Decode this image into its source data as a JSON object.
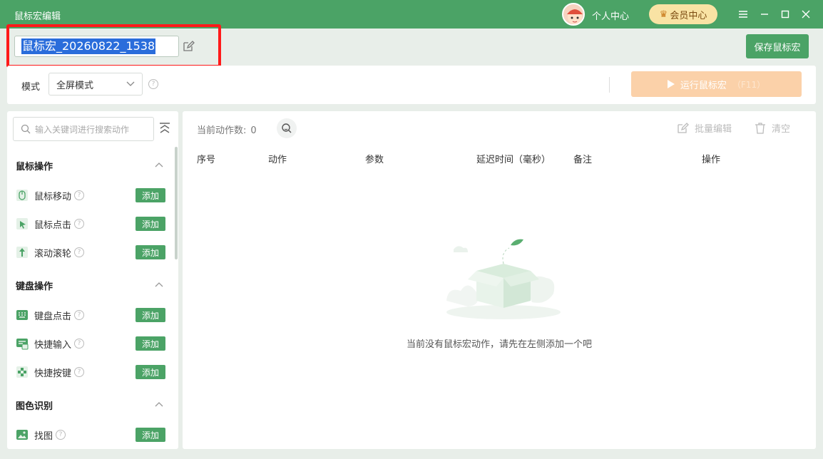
{
  "titlebar": {
    "title": "鼠标宏编辑",
    "user_center": "个人中心",
    "vip": "会员中心"
  },
  "header": {
    "macro_name": "鼠标宏_20260822_1538",
    "save_label": "保存鼠标宏"
  },
  "mode": {
    "label": "模式",
    "selected": "全屏模式",
    "run_label": "运行鼠标宏",
    "run_hotkey": "（F11）"
  },
  "sidebar": {
    "search_placeholder": "输入关键词进行搜索动作",
    "add_label": "添加",
    "groups": [
      {
        "title": "鼠标操作",
        "items": [
          "鼠标移动",
          "鼠标点击",
          "滚动滚轮"
        ]
      },
      {
        "title": "键盘操作",
        "items": [
          "键盘点击",
          "快捷输入",
          "快捷按键"
        ]
      },
      {
        "title": "图色识别",
        "items": [
          "找图"
        ]
      }
    ]
  },
  "main": {
    "count_label": "当前动作数:",
    "count_value": "0",
    "batch_edit": "批量编辑",
    "clear": "清空",
    "columns": [
      "序号",
      "动作",
      "参数",
      "延迟时间（毫秒）",
      "备注",
      "操作"
    ],
    "empty_text": "当前没有鼠标宏动作，请先在左侧添加一个吧"
  },
  "colors": {
    "brand_green": "#4ba366",
    "run_button_disabled": "#fbd1a9",
    "highlight_red": "#ff1a1a"
  }
}
